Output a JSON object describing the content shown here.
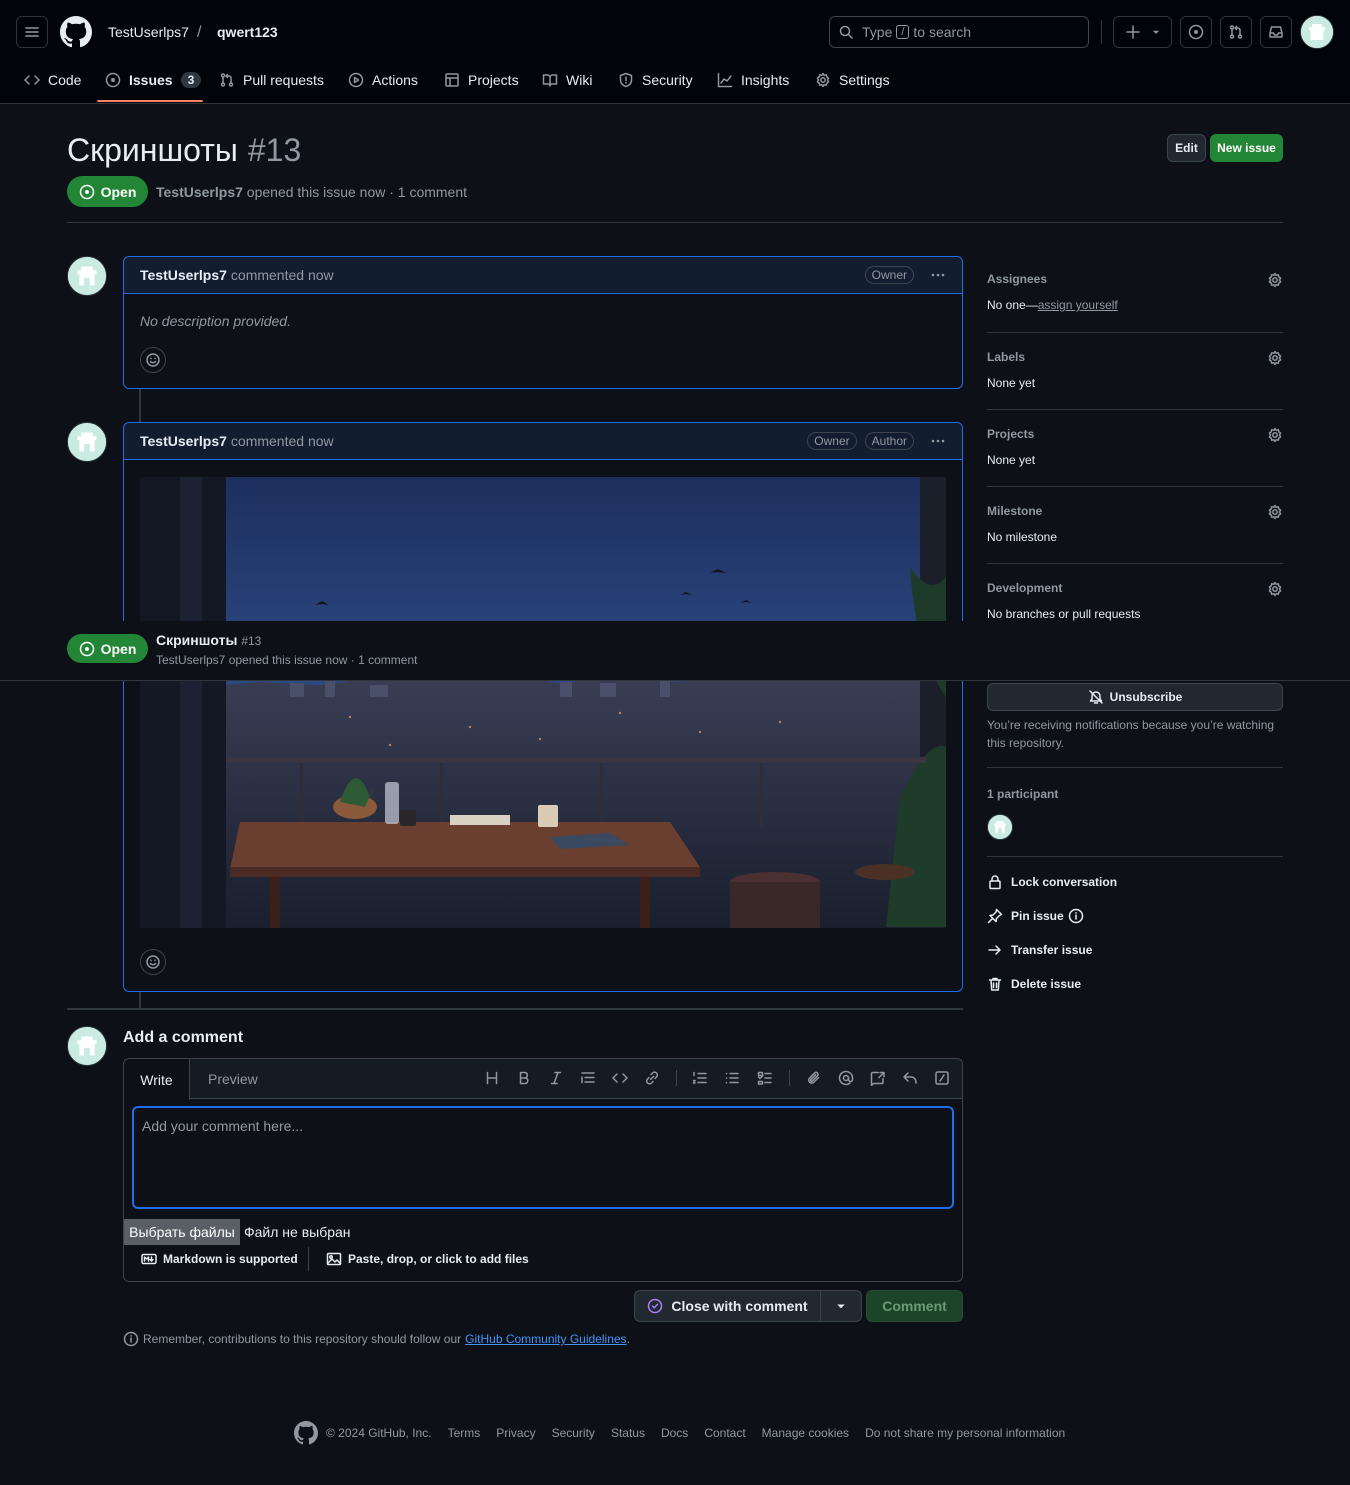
{
  "header": {
    "owner": "TestUserlps7",
    "separator": "/",
    "repo": "qwert123",
    "search_prefix": "Type",
    "search_key": "/",
    "search_suffix": "to search"
  },
  "tabs": [
    {
      "label": "Code"
    },
    {
      "label": "Issues",
      "count": "3"
    },
    {
      "label": "Pull requests"
    },
    {
      "label": "Actions"
    },
    {
      "label": "Projects"
    },
    {
      "label": "Wiki"
    },
    {
      "label": "Security"
    },
    {
      "label": "Insights"
    },
    {
      "label": "Settings"
    }
  ],
  "issue": {
    "title": "Скриншоты",
    "number": "#13",
    "state": "Open",
    "author": "TestUserlps7",
    "meta": "opened this issue now · 1 comment",
    "edit_label": "Edit",
    "new_issue_label": "New issue"
  },
  "sticky": {
    "state": "Open",
    "title": "Скриншоты",
    "number": "#13",
    "meta": "TestUserlps7 opened this issue now · 1 comment"
  },
  "comments": [
    {
      "author": "TestUserlps7",
      "action": "commented now",
      "roles": [
        "Owner"
      ],
      "body": "No description provided."
    },
    {
      "author": "TestUserlps7",
      "action": "commented now",
      "roles": [
        "Owner",
        "Author"
      ]
    }
  ],
  "sidebar": {
    "assignees": {
      "title": "Assignees",
      "value": "No one—",
      "link": "assign yourself"
    },
    "labels": {
      "title": "Labels",
      "value": "None yet"
    },
    "projects": {
      "title": "Projects",
      "value": "None yet"
    },
    "milestone": {
      "title": "Milestone",
      "value": "No milestone"
    },
    "development": {
      "title": "Development",
      "value": "No branches or pull requests"
    },
    "unsubscribe": "Unsubscribe",
    "notification_text": "You’re receiving notifications because you’re watching this repository.",
    "participants": "1 participant",
    "actions": [
      "Lock conversation",
      "Pin issue",
      "Transfer issue",
      "Delete issue"
    ]
  },
  "composer": {
    "heading": "Add a comment",
    "tab_write": "Write",
    "tab_preview": "Preview",
    "placeholder": "Add your comment here...",
    "file_button": "Выбрать файлы",
    "file_status": "Файл не выбран",
    "markdown_note": "Markdown is supported",
    "attach_note": "Paste, drop, or click to add files",
    "close_label": "Close with comment",
    "comment_label": "Comment",
    "guideline_prefix": "Remember, contributions to this repository should follow our",
    "guideline_link": "GitHub Community Guidelines",
    "guideline_suffix": "."
  },
  "footer": {
    "copyright": "© 2024 GitHub, Inc.",
    "links": [
      "Terms",
      "Privacy",
      "Security",
      "Status",
      "Docs",
      "Contact",
      "Manage cookies",
      "Do not share my personal information"
    ]
  },
  "colors": {
    "accent": "#1f6feb",
    "open_green": "#238636",
    "link": "#4493f8",
    "background": "#0d1117"
  }
}
